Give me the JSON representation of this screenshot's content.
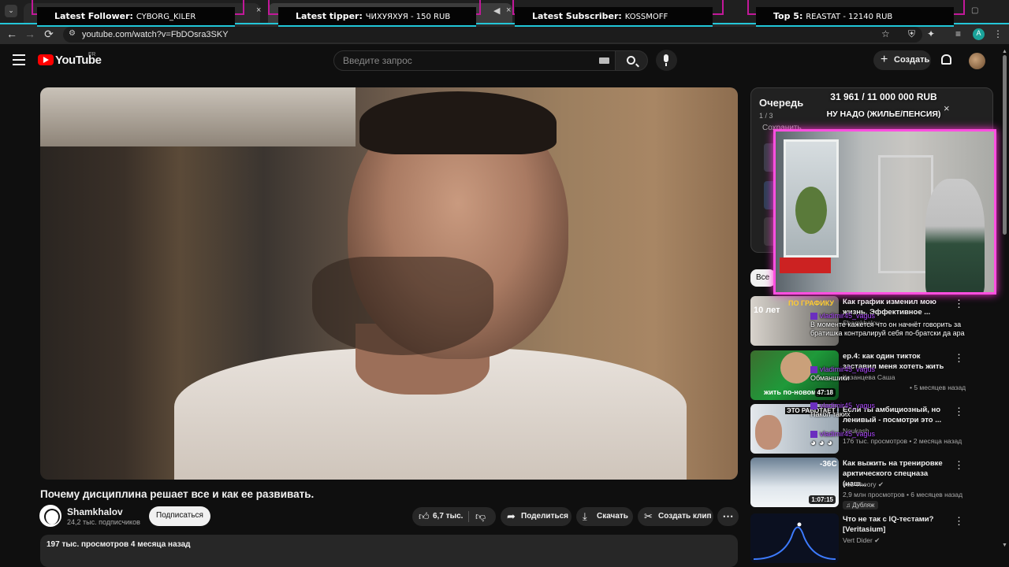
{
  "browser": {
    "tab_close": "×",
    "url": "youtube.com/watch?v=FbDOsra3SKY",
    "nav": {
      "back": "←",
      "forward": "→",
      "reload": "⟳"
    }
  },
  "stream_overlay": {
    "latest_follower": {
      "label": "Latest Follower:",
      "value": "CYBORG_KILER"
    },
    "latest_tipper": {
      "label": "Latest tipper:",
      "value": "ЧИХУЯХУЯ - 150 RUB"
    },
    "latest_subscriber": {
      "label": "Latest Subscriber:",
      "value": "KOSSMOFF"
    },
    "top5": {
      "label": "Top 5:",
      "value": "REASTAT - 12140 RUB"
    },
    "donation_goal": "31 961 / 11 000 000 RUB",
    "goal_name": "НУ НАДО (ЖИЛЬЕ/ПЕНСИЯ)",
    "goal_close": "×",
    "chat": [
      {
        "user": "vladimir45_vagus",
        "text": "В моменте кажется что он начнёт говорить за братишка контралируй себя по-братски да ара"
      },
      {
        "user": "vladimir45_vagus",
        "text": "Обманшики"
      },
      {
        "user": "vladimir45_vagus",
        "text": "Накол таких"
      },
      {
        "user": "vladimir45_vagus",
        "text": ""
      }
    ]
  },
  "youtube": {
    "logo_text": "YouTube",
    "country": "FR",
    "search_placeholder": "Введите запрос",
    "create_label": "Создать",
    "video": {
      "title": "Почему дисциплина решает все и как ее развивать.",
      "channel": "Shamkhalov",
      "subscribers": "24,2 тыс. подписчиков",
      "subscribe_label": "Подписаться",
      "likes": "6,7 тыс.",
      "share_label": "Поделиться",
      "download_label": "Скачать",
      "clip_label": "Создать клип",
      "views_line": "197 тыс. просмотров  4 месяца назад"
    },
    "queue": {
      "title": "Очередь",
      "count": "1 / 3",
      "save_label": "Сохранить"
    },
    "filter_chip": "Все",
    "recommendations": [
      {
        "title": "Как график изменил мою жизнь. Эффективное ...",
        "channel": "Shamkhalov",
        "meta": "",
        "duration": "",
        "thumb_text": "ПО ГРАФИКУ",
        "thumb_sub": "10 лет"
      },
      {
        "title": "ер.4: как один тикток заставил меня хотеть жить",
        "channel": "Казанцева Саша",
        "meta": "• 5 месяцев назад",
        "duration": "47:18",
        "thumb_text": "жить по-новому",
        "thumb_sub": ""
      },
      {
        "title": "Если ты амбициозный, но ленивый - посмотри это ...",
        "channel": "Noukash",
        "meta": "176 тыс. просмотров • 2 месяца назад",
        "duration": "",
        "thumb_text": "ЭТО РАБОТАЕТ",
        "thumb_sub": ""
      },
      {
        "title": "Как выжить на тренировке арктического спецназа (наш...",
        "channel": "Yes Theory",
        "meta": "2,9 млн просмотров • 6 месяцев назад",
        "duration": "1:07:15",
        "thumb_text": "-36C",
        "thumb_sub": "",
        "badge": "Дубляж"
      },
      {
        "title": "Что не так с IQ-тестами? [Veritasium]",
        "channel": "Vert Dider",
        "meta": "",
        "duration": "",
        "thumb_text": "",
        "thumb_sub": ""
      }
    ]
  }
}
